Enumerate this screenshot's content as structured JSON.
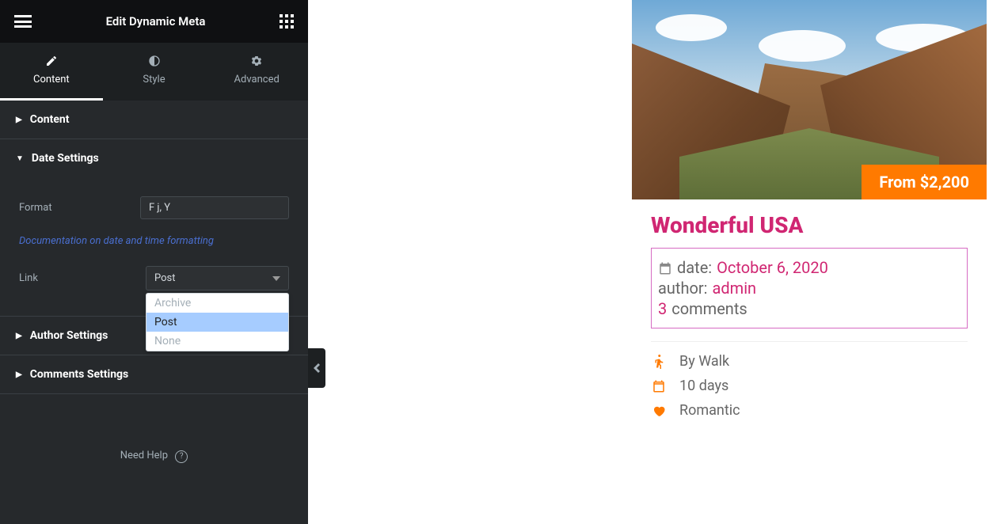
{
  "header": {
    "title": "Edit Dynamic Meta"
  },
  "tabs": {
    "content": "Content",
    "style": "Style",
    "advanced": "Advanced"
  },
  "sections": {
    "content": "Content",
    "date_settings": "Date Settings",
    "author_settings": "Author Settings",
    "comments_settings": "Comments Settings"
  },
  "date_settings": {
    "format_label": "Format",
    "format_value": "F j, Y",
    "doc_link": "Documentation on date and time formatting",
    "link_label": "Link",
    "link_value": "Post",
    "options": {
      "archive": "Archive",
      "post": "Post",
      "none": "None"
    }
  },
  "footer": {
    "need_help": "Need Help"
  },
  "preview": {
    "price_tag": "From $2,200",
    "title": "Wonderful USA",
    "meta": {
      "date_label": "date:",
      "date_value": "October 6, 2020",
      "author_label": "author:",
      "author_value": "admin",
      "comments_count": "3",
      "comments_text": "comments"
    },
    "attrs": {
      "walk": "By Walk",
      "duration": "10 days",
      "mood": "Romantic"
    }
  }
}
